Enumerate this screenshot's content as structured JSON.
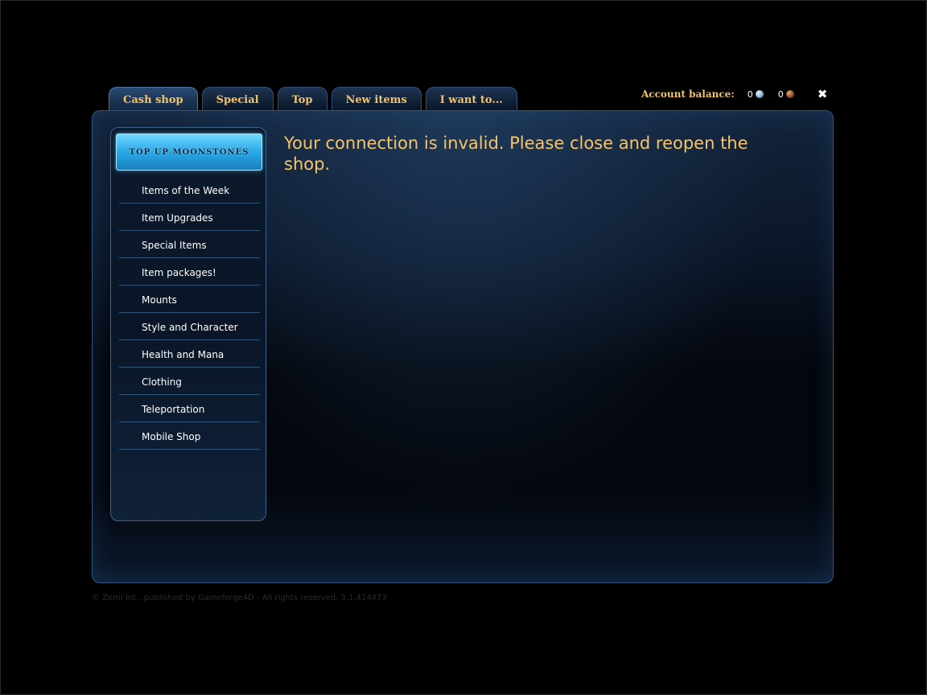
{
  "tabs": [
    {
      "label": "Cash shop",
      "active": true
    },
    {
      "label": "Special",
      "active": false
    },
    {
      "label": "Top",
      "active": false
    },
    {
      "label": "New items",
      "active": false
    },
    {
      "label": "I want to...",
      "active": false
    }
  ],
  "account": {
    "label": "Account balance:",
    "moonstones": "0",
    "moonstone_icon": "silver-coin-icon",
    "coins": "0",
    "coin_icon": "bronze-coin-icon"
  },
  "close_icon": "close-icon",
  "sidebar": {
    "topup_label": "TOP UP MOONSTONES",
    "items": [
      {
        "label": "Items of the Week"
      },
      {
        "label": "Item Upgrades"
      },
      {
        "label": "Special Items"
      },
      {
        "label": "Item packages!"
      },
      {
        "label": "Mounts"
      },
      {
        "label": "Style and Character"
      },
      {
        "label": "Health and Mana"
      },
      {
        "label": "Clothing"
      },
      {
        "label": "Teleportation"
      },
      {
        "label": "Mobile Shop"
      }
    ]
  },
  "main": {
    "message": "Your connection is invalid. Please close and reopen the shop."
  },
  "footer": {
    "text": "© Zemi Int., published by Gameforge4D - All rights reserved. 3.1.414473"
  },
  "colors": {
    "accent_gold": "#f1c267",
    "panel_border": "#2f5582",
    "topup_blue": "#28a8e6"
  }
}
